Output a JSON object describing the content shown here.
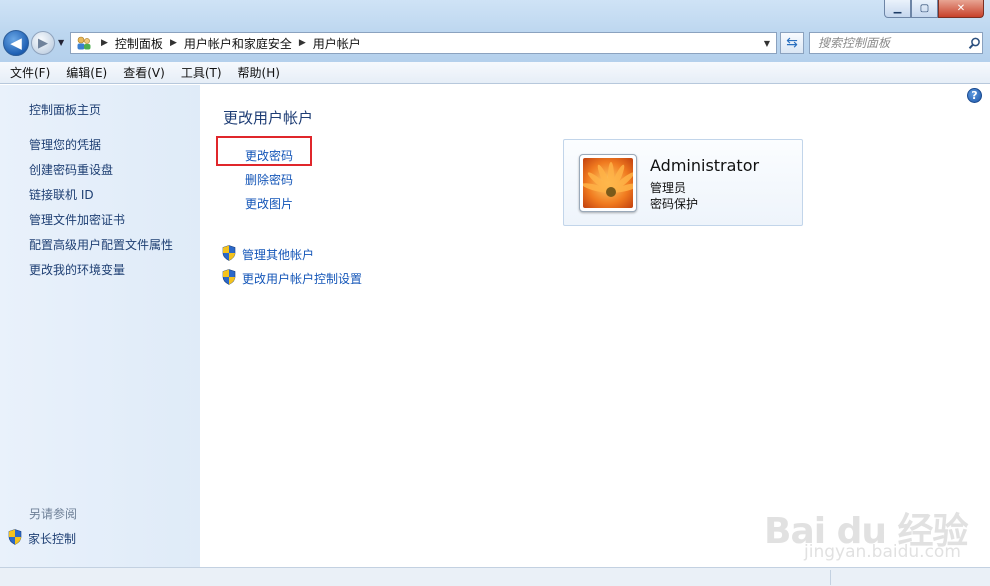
{
  "window": {
    "controls": {
      "minimize": "▁",
      "maximize": "▢",
      "close": "✕"
    }
  },
  "nav": {
    "back_icon": "arrow-left-icon",
    "forward_icon": "arrow-right-icon"
  },
  "address": {
    "crumbs": [
      "控制面板",
      "用户帐户和家庭安全",
      "用户帐户"
    ]
  },
  "search": {
    "placeholder": "搜索控制面板"
  },
  "menu": [
    "文件(F)",
    "编辑(E)",
    "查看(V)",
    "工具(T)",
    "帮助(H)"
  ],
  "sidebar": {
    "home": "控制面板主页",
    "links": [
      "管理您的凭据",
      "创建密码重设盘",
      "链接联机 ID",
      "管理文件加密证书",
      "配置高级用户配置文件属性",
      "更改我的环境变量"
    ],
    "see_also_heading": "另请参阅",
    "family_safety": "家长控制"
  },
  "main": {
    "title": "更改用户帐户",
    "tasks": [
      "更改密码",
      "删除密码",
      "更改图片"
    ],
    "shield_tasks": [
      "管理其他帐户",
      "更改用户帐户控制设置"
    ],
    "account": {
      "name": "Administrator",
      "role": "管理员",
      "status": "密码保护"
    }
  },
  "watermark": {
    "brand": "Bai du 经验",
    "site": "jingyan.baidu.com"
  },
  "colors": {
    "link": "#1456b8",
    "sidebar_link": "#1e3f73",
    "highlight": "#e0262b",
    "title": "#1e3d75"
  }
}
